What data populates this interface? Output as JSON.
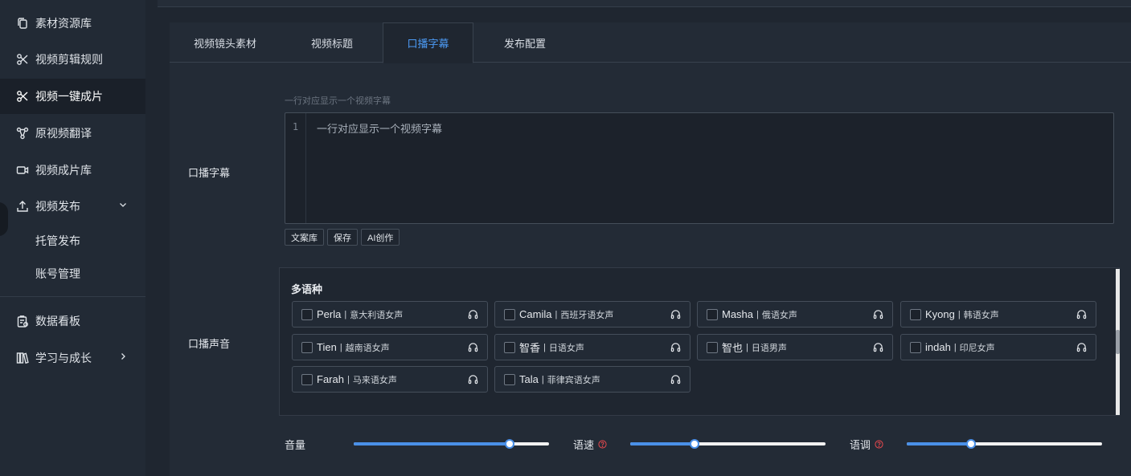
{
  "sidebar": {
    "items": [
      {
        "label": "素材资源库",
        "icon": "copy-icon"
      },
      {
        "label": "视频剪辑规则",
        "icon": "scissors-icon"
      },
      {
        "label": "视频一键成片",
        "icon": "scissors-icon",
        "active": true
      },
      {
        "label": "原视频翻译",
        "icon": "nodes-icon"
      },
      {
        "label": "视频成片库",
        "icon": "video-camera-icon"
      },
      {
        "label": "视频发布",
        "icon": "upload-icon",
        "expanded": true
      }
    ],
    "sub_items": [
      "托管发布",
      "账号管理"
    ],
    "bottom_items": [
      {
        "label": "数据看板",
        "icon": "clipboard-icon"
      },
      {
        "label": "学习与成长",
        "icon": "books-icon"
      }
    ]
  },
  "tabs": [
    "视频镜头素材",
    "视频标题",
    "口播字幕",
    "发布配置"
  ],
  "active_tab": "口播字幕",
  "subtitle": {
    "label": "口播字幕",
    "hint": "一行对应显示一个视频字幕",
    "line_number": "1",
    "placeholder": "一行对应显示一个视频字幕",
    "buttons": [
      "文案库",
      "保存",
      "AI创作"
    ]
  },
  "voice": {
    "label": "口播声音",
    "group_title": "多语种",
    "options": [
      {
        "name": "Perla",
        "desc": "意大利语女声"
      },
      {
        "name": "Camila",
        "desc": "西班牙语女声"
      },
      {
        "name": "Masha",
        "desc": "俄语女声"
      },
      {
        "name": "Kyong",
        "desc": "韩语女声"
      },
      {
        "name": "Tien",
        "desc": "越南语女声"
      },
      {
        "name": "智香",
        "desc": "日语女声"
      },
      {
        "name": "智也",
        "desc": "日语男声"
      },
      {
        "name": "indah",
        "desc": "印尼女声"
      },
      {
        "name": "Farah",
        "desc": "马来语女声"
      },
      {
        "name": "Tala",
        "desc": "菲律宾语女声"
      }
    ],
    "separator": "|"
  },
  "sliders": {
    "volume": {
      "label": "音量",
      "value": 0.8
    },
    "speed": {
      "label": "语速",
      "value": 0.33,
      "help": true
    },
    "pitch": {
      "label": "语调",
      "value": 0.33,
      "help": true
    }
  },
  "colors": {
    "accent": "#4a90e8",
    "active_tab": "#4c9bf5",
    "help": "#e5484d"
  }
}
